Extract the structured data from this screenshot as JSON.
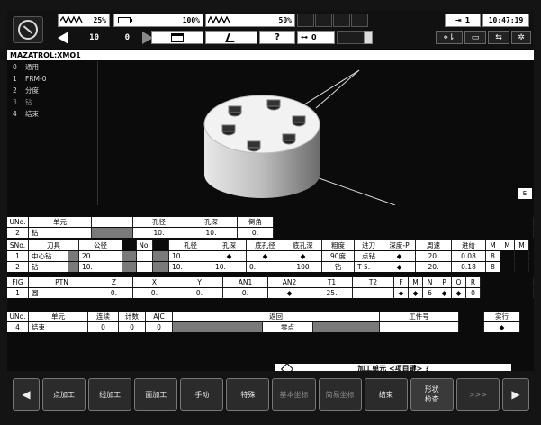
{
  "status": {
    "spindle_load": "25%",
    "battery": "100%",
    "feed_override": "50%",
    "counter_a": "10",
    "counter_b": "0",
    "program_count": "0",
    "user_label": "1",
    "help_label": "?",
    "clock": "10:47:19"
  },
  "program": {
    "title": "MAZATROL:XMO1"
  },
  "units": [
    {
      "no": "0",
      "name": "通用"
    },
    {
      "no": "1",
      "name": "FRM-0"
    },
    {
      "no": "2",
      "name": "分度"
    },
    {
      "no": "3",
      "name": "钻"
    },
    {
      "no": "4",
      "name": "结束"
    }
  ],
  "side_tab": "E",
  "unit_table": {
    "headers": [
      "UNo.",
      "单元",
      "",
      "孔径",
      "孔深",
      "倒角",
      ""
    ],
    "row": [
      "2",
      "钻",
      "",
      "10.",
      "10.",
      "0.",
      ""
    ]
  },
  "tool_table": {
    "headers": [
      "SNo.",
      "刀具",
      "公径",
      "No.",
      "",
      "孔径",
      "孔深",
      "底孔径",
      "底孔深",
      "粗度",
      "进刀",
      "深度-P",
      "周速",
      "进给",
      "M",
      "M",
      "M"
    ],
    "rows": [
      [
        "1",
        "中心钻",
        "20.",
        "",
        "",
        "10.",
        "◆",
        "◆",
        "◆",
        "90度",
        "点钻",
        "◆",
        "20.",
        "0.08",
        "8",
        "",
        ""
      ],
      [
        "2",
        "钻",
        "10.",
        "",
        "",
        "10.",
        "10.",
        "0.",
        "100",
        "钻",
        "T 5.",
        "◆",
        "20.",
        "0.18",
        "8",
        "",
        ""
      ]
    ]
  },
  "shape_table": {
    "headers": [
      "FIG",
      "PTN",
      "Z",
      "X",
      "Y",
      "AN1",
      "AN2",
      "T1",
      "T2",
      "F",
      "M",
      "N",
      "P",
      "Q",
      "R"
    ],
    "row": [
      "1",
      "圆",
      "0.",
      "0.",
      "0.",
      "0.",
      "◆",
      "25.",
      "",
      "◆",
      "◆",
      "6",
      "◆",
      "◆",
      "0"
    ]
  },
  "end_table": {
    "headers": [
      "UNo.",
      "单元",
      "连续",
      "计数",
      "AJC",
      "返回",
      "",
      "工件号",
      "",
      "实行"
    ],
    "row": [
      "4",
      "结束",
      "0",
      "0",
      "0",
      "零点",
      "",
      "",
      "",
      "◆"
    ]
  },
  "message": "加工单元 <项目键> ?",
  "softkeys": [
    "点加工",
    "线加工",
    "面加工",
    "手动",
    "特殊",
    "基本坐标",
    "简易坐标",
    "结束",
    "形状\n检查",
    ">>>"
  ]
}
